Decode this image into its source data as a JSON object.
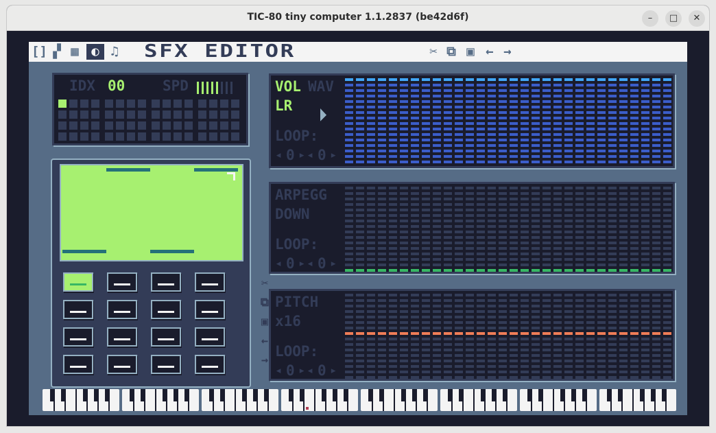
{
  "window": {
    "title": "TIC-80 tiny computer 1.1.2837 (be42d6f)",
    "minimize_label": "–",
    "maximize_label": "□",
    "close_label": "✕"
  },
  "menubar": {
    "tools": [
      {
        "name": "code-editor",
        "label": "[]",
        "selected": false
      },
      {
        "name": "sprite-editor",
        "label": "▞",
        "selected": false
      },
      {
        "name": "map-editor",
        "label": "▦",
        "selected": false
      },
      {
        "name": "sfx-editor",
        "label": "◐",
        "selected": true
      },
      {
        "name": "music-editor",
        "label": "♫",
        "selected": false
      }
    ],
    "title": "SFX EDITOR",
    "actions": [
      {
        "name": "cut",
        "label": "✂"
      },
      {
        "name": "copy",
        "label": "⧉"
      },
      {
        "name": "paste",
        "label": "▣"
      },
      {
        "name": "undo",
        "label": "←"
      },
      {
        "name": "redo",
        "label": "→"
      }
    ]
  },
  "sfx": {
    "idx_label": "IDX",
    "idx_value": "00",
    "spd_label": "SPD",
    "spd_level": 0.5
  },
  "waveforms": {
    "side_tools": [
      "✂",
      "⧉",
      "▣",
      "←",
      "→"
    ]
  },
  "envelopes": [
    {
      "tabs": [
        "VOL",
        "WAV"
      ],
      "active_tab": "VOL",
      "mode": "LR",
      "loop_label": "LOOP:",
      "loop_start": "0",
      "loop_size": "0",
      "arrow_left": "◂",
      "arrow_right": "▸"
    },
    {
      "tabs": [
        "ARPEGG"
      ],
      "active_tab": "",
      "mode": "DOWN",
      "loop_label": "LOOP:",
      "loop_start": "0",
      "loop_size": "0",
      "arrow_left": "◂",
      "arrow_right": "▸"
    },
    {
      "tabs": [
        "PITCH"
      ],
      "active_tab": "",
      "mode": "x16",
      "loop_label": "LOOP:",
      "loop_start": "0",
      "loop_size": "0",
      "arrow_left": "◂",
      "arrow_right": "▸"
    }
  ],
  "colors": {
    "screen_bg": "#566c86",
    "dark": "#1a1c2c",
    "grid_off": "#333c57",
    "green": "#a7f070",
    "volume_blue": "#3b5dc9",
    "volume_light": "#41a6f6",
    "arpeggio_green": "#38b764",
    "pitch_orange": "#ef7d57"
  }
}
